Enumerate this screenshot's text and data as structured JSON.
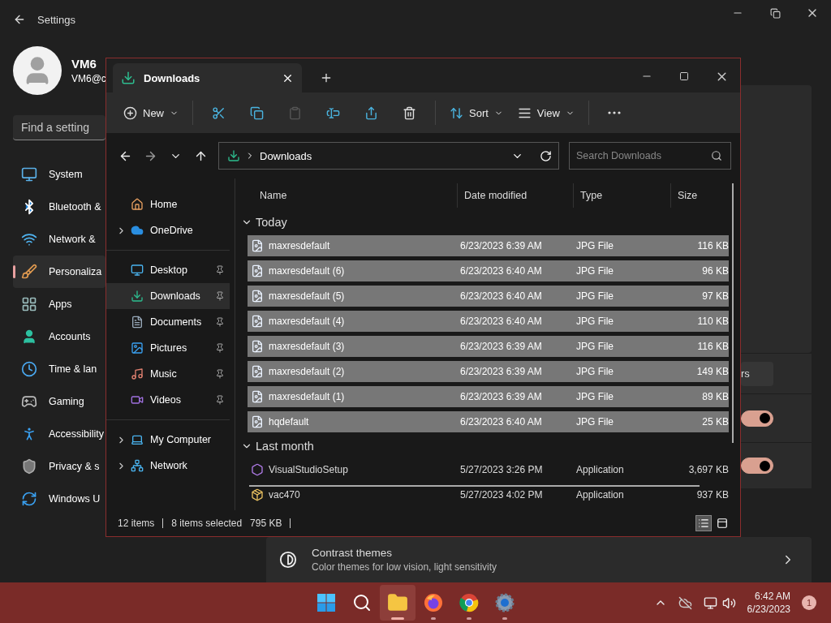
{
  "settings": {
    "title": "Settings",
    "user": {
      "name": "VM6",
      "email": "VM6@c"
    },
    "search": {
      "placeholder": "Find a setting"
    },
    "nav": [
      {
        "label": "System",
        "kind": "system",
        "selected": false
      },
      {
        "label": "Bluetooth &",
        "kind": "bluetooth",
        "selected": false
      },
      {
        "label": "Network &",
        "kind": "network",
        "selected": false
      },
      {
        "label": "Personaliza",
        "kind": "brush",
        "selected": true
      },
      {
        "label": "Apps",
        "kind": "apps",
        "selected": false
      },
      {
        "label": "Accounts",
        "kind": "accounts",
        "selected": false
      },
      {
        "label": "Time & lan",
        "kind": "time",
        "selected": false
      },
      {
        "label": "Gaming",
        "kind": "gaming",
        "selected": false
      },
      {
        "label": "Accessibility",
        "kind": "accessibility",
        "selected": false
      },
      {
        "label": "Privacy & s",
        "kind": "privacy",
        "selected": false
      },
      {
        "label": "Windows U",
        "kind": "update",
        "selected": false
      }
    ],
    "panel": {
      "button": "rs",
      "toggles": [
        {
          "on": true
        },
        {
          "on": true
        }
      ],
      "contrast": {
        "title": "Contrast themes",
        "subtitle": "Color themes for low vision, light sensitivity"
      }
    }
  },
  "explorer": {
    "tab": {
      "title": "Downloads"
    },
    "toolbar": [
      {
        "kind": "new",
        "label": "New",
        "disabled": false
      },
      {
        "kind": "cut",
        "disabled": false
      },
      {
        "kind": "copy",
        "disabled": false
      },
      {
        "kind": "paste",
        "disabled": true
      },
      {
        "kind": "rename",
        "disabled": false
      },
      {
        "kind": "share",
        "disabled": false
      },
      {
        "kind": "delete",
        "disabled": false
      },
      {
        "kind": "sort",
        "label": "Sort",
        "disabled": false
      },
      {
        "kind": "view",
        "label": "View",
        "disabled": false
      },
      {
        "kind": "more",
        "disabled": false
      }
    ],
    "address": {
      "path": "Downloads"
    },
    "search": {
      "placeholder": "Search Downloads"
    },
    "sidebar": [
      {
        "items": [
          {
            "label": "Home",
            "kind": "home",
            "expandable": false,
            "pinned": false,
            "selected": false
          },
          {
            "label": "OneDrive",
            "kind": "cloud",
            "expandable": true,
            "pinned": false,
            "selected": false
          }
        ]
      },
      {
        "items": [
          {
            "label": "Desktop",
            "kind": "desktop",
            "expandable": false,
            "pinned": true,
            "selected": false
          },
          {
            "label": "Downloads",
            "kind": "downloads",
            "expandable": false,
            "pinned": true,
            "selected": true
          },
          {
            "label": "Documents",
            "kind": "documents",
            "expandable": false,
            "pinned": true,
            "selected": false
          },
          {
            "label": "Pictures",
            "kind": "pictures",
            "expandable": false,
            "pinned": true,
            "selected": false
          },
          {
            "label": "Music",
            "kind": "music",
            "expandable": false,
            "pinned": true,
            "selected": false
          },
          {
            "label": "Videos",
            "kind": "videos",
            "expandable": false,
            "pinned": true,
            "selected": false
          }
        ]
      },
      {
        "items": [
          {
            "label": "My Computer",
            "kind": "computer",
            "expandable": true,
            "pinned": false,
            "selected": false
          },
          {
            "label": "Network",
            "kind": "network",
            "expandable": true,
            "pinned": false,
            "selected": false
          }
        ]
      }
    ],
    "columns": [
      "Name",
      "Date modified",
      "Type",
      "Size"
    ],
    "groups": [
      {
        "label": "Today",
        "expanded": true,
        "rows": [
          {
            "name": "maxresdefault",
            "date": "6/23/2023 6:39 AM",
            "type": "JPG File",
            "size": "116 KB",
            "kind": "image",
            "selected": true
          },
          {
            "name": "maxresdefault (6)",
            "date": "6/23/2023 6:40 AM",
            "type": "JPG File",
            "size": "96 KB",
            "kind": "image",
            "selected": true
          },
          {
            "name": "maxresdefault (5)",
            "date": "6/23/2023 6:40 AM",
            "type": "JPG File",
            "size": "97 KB",
            "kind": "image",
            "selected": true
          },
          {
            "name": "maxresdefault (4)",
            "date": "6/23/2023 6:40 AM",
            "type": "JPG File",
            "size": "110 KB",
            "kind": "image",
            "selected": true
          },
          {
            "name": "maxresdefault (3)",
            "date": "6/23/2023 6:39 AM",
            "type": "JPG File",
            "size": "116 KB",
            "kind": "image",
            "selected": true
          },
          {
            "name": "maxresdefault (2)",
            "date": "6/23/2023 6:39 AM",
            "type": "JPG File",
            "size": "149 KB",
            "kind": "image",
            "selected": true
          },
          {
            "name": "maxresdefault (1)",
            "date": "6/23/2023 6:39 AM",
            "type": "JPG File",
            "size": "89 KB",
            "kind": "image",
            "selected": true
          },
          {
            "name": "hqdefault",
            "date": "6/23/2023 6:40 AM",
            "type": "JPG File",
            "size": "25 KB",
            "kind": "image",
            "selected": true
          }
        ]
      },
      {
        "label": "Last month",
        "expanded": true,
        "rows": [
          {
            "name": "VisualStudioSetup",
            "date": "5/27/2023 3:26 PM",
            "type": "Application",
            "size": "3,697 KB",
            "kind": "vs",
            "selected": false
          },
          {
            "name": "vac470",
            "date": "5/27/2023 4:02 PM",
            "type": "Application",
            "size": "937 KB",
            "kind": "installer",
            "selected": false
          }
        ]
      }
    ],
    "status": {
      "count": "12 items",
      "selection": "8 items selected",
      "size": "795 KB"
    },
    "views": [
      {
        "kind": "details",
        "selected": true
      },
      {
        "kind": "tiles",
        "selected": false
      }
    ]
  },
  "taskbar": {
    "apps": [
      {
        "kind": "start",
        "active": false
      },
      {
        "kind": "search",
        "active": false
      },
      {
        "kind": "explorer",
        "active": true
      },
      {
        "kind": "firefox",
        "active": false
      },
      {
        "kind": "chrome",
        "active": false
      },
      {
        "kind": "settings",
        "active": false
      }
    ],
    "time": "6:42 AM",
    "date": "6/23/2023",
    "notifications": "1"
  }
}
